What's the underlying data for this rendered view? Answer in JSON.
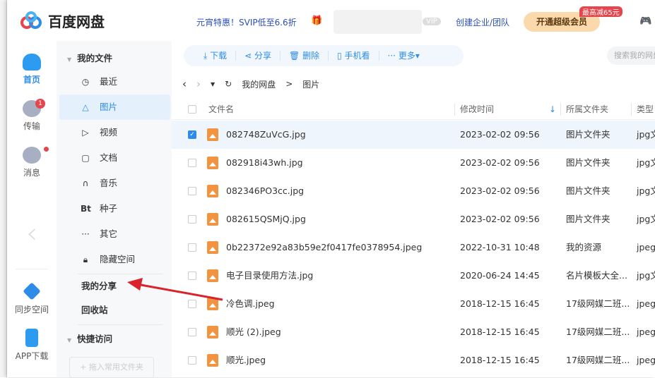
{
  "header": {
    "app_title": "百度网盘",
    "promo": "元宵特惠！SVIP低至6.6折",
    "vip_tag": "VIP",
    "team": "创建企业/团队",
    "svip_button": "开通超级会员",
    "svip_badge": "最高减65元"
  },
  "nav": [
    {
      "label": "首页",
      "active": true
    },
    {
      "label": "传输",
      "badge": "1"
    },
    {
      "label": "消息"
    },
    {
      "label": "同步空间"
    },
    {
      "label": "APP下载"
    }
  ],
  "sidebar": {
    "my_files": "我的文件",
    "items": [
      "最近",
      "图片",
      "视频",
      "文档",
      "音乐",
      "种子",
      "其它",
      "隐藏空间"
    ],
    "my_share": "我的分享",
    "recycle": "回收站",
    "quick_access": "快捷访问",
    "add_folder": "+ 拖入常用文件夹"
  },
  "toolbar": {
    "download": "下载",
    "share": "分享",
    "delete": "删除",
    "phone": "手机看",
    "more": "更多",
    "search_placeholder": "搜索我的网盘文件"
  },
  "breadcrumb": [
    "我的网盘",
    "图片"
  ],
  "table": {
    "headers": [
      "文件名",
      "修改时间",
      "所属文件夹",
      "类型"
    ],
    "rows": [
      {
        "name": "082748ZuVcG.jpg",
        "time": "2023-02-02 09:56",
        "folder": "图片文件夹",
        "type": "jpg文件",
        "checked": true
      },
      {
        "name": "082918i43wh.jpg",
        "time": "2023-02-02 09:56",
        "folder": "图片文件夹",
        "type": "jpg文件"
      },
      {
        "name": "082346PO3cc.jpg",
        "time": "2023-02-02 09:56",
        "folder": "图片文件夹",
        "type": "jpg文件"
      },
      {
        "name": "082615QSMjQ.jpg",
        "time": "2023-02-02 09:56",
        "folder": "图片文件夹",
        "type": "jpg文件"
      },
      {
        "name": "0b22372e92a83b59e2f0417fe0378954.jpeg",
        "time": "2022-10-31 10:48",
        "folder": "我的资源",
        "type": "jpeg文件"
      },
      {
        "name": "电子目录使用方法.jpg",
        "time": "2020-06-24 14:45",
        "folder": "名片模板大全...",
        "type": "jpg文件"
      },
      {
        "name": "冷色调.jpeg",
        "time": "2018-12-15 16:45",
        "folder": "17级网媒二班...",
        "type": "jpeg文件"
      },
      {
        "name": "顺光 (2).jpeg",
        "time": "2018-12-15 16:45",
        "folder": "17级网媒二班...",
        "type": "jpeg文件"
      },
      {
        "name": "顺光.jpeg",
        "time": "2018-12-15 16:45",
        "folder": "17级网媒二班...",
        "type": "jpeg文件"
      }
    ]
  },
  "colors": {
    "accent": "#2d8ce8",
    "file_icon": "#f3923f",
    "annotation_arrow": "#d9222a"
  }
}
